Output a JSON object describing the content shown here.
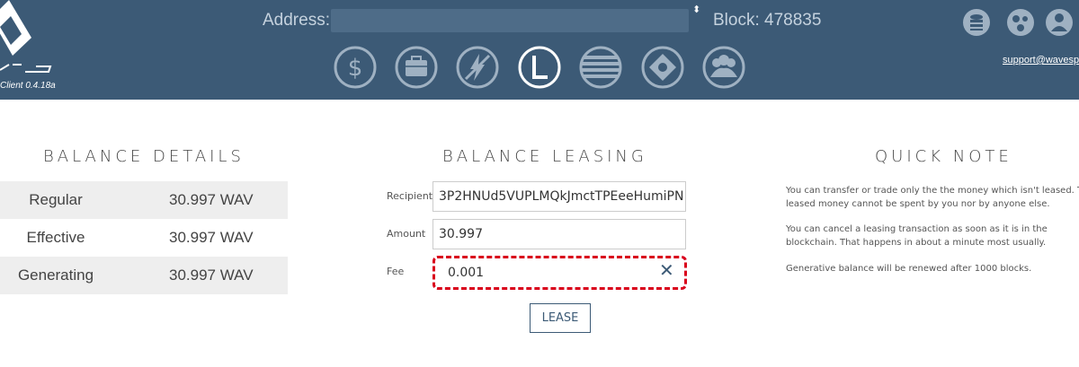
{
  "header": {
    "version": "Client 0.4.18a",
    "address_label": "Address:",
    "block_label": "Block: 478835",
    "support_link": "support@wavesp",
    "colors": {
      "header_bg": "#3c5a76",
      "accent": "#3c5a76",
      "highlight": "#d9001b"
    },
    "nav_icons": [
      "wallet-dollar-icon",
      "briefcase-icon",
      "no-dex-icon",
      "leasing-icon",
      "history-icon",
      "community-icon",
      "contacts-icon"
    ],
    "active_nav": "leasing-icon",
    "top_right_icons": [
      "database-icon",
      "network-icon",
      "settings-icon"
    ]
  },
  "balance_details": {
    "title": "BALANCE DETAILS",
    "rows": [
      {
        "label": "Regular",
        "value": "30.997 WAV"
      },
      {
        "label": "Effective",
        "value": "30.997 WAV"
      },
      {
        "label": "Generating",
        "value": "30.997 WAV"
      }
    ]
  },
  "balance_leasing": {
    "title": "BALANCE LEASING",
    "recipient_label": "Recipient",
    "recipient_value": "3P2HNUd5VUPLMQkJmctTPEeeHumiPN",
    "amount_label": "Amount",
    "amount_value": "30.997",
    "fee_label": "Fee",
    "fee_value": "0.001",
    "lease_button": "LEASE"
  },
  "quick_note": {
    "title": "QUICK NOTE",
    "lines_1": [
      "You can transfer or trade only the the money which isn't leased. T",
      "leased money cannot be spent by you nor by anyone else."
    ],
    "lines_2": [
      "You can cancel a leasing transaction as soon as it is in the",
      "blockchain. That happens in about a minute most usually."
    ],
    "lines_3": [
      "Generative balance will be renewed after 1000 blocks."
    ]
  }
}
